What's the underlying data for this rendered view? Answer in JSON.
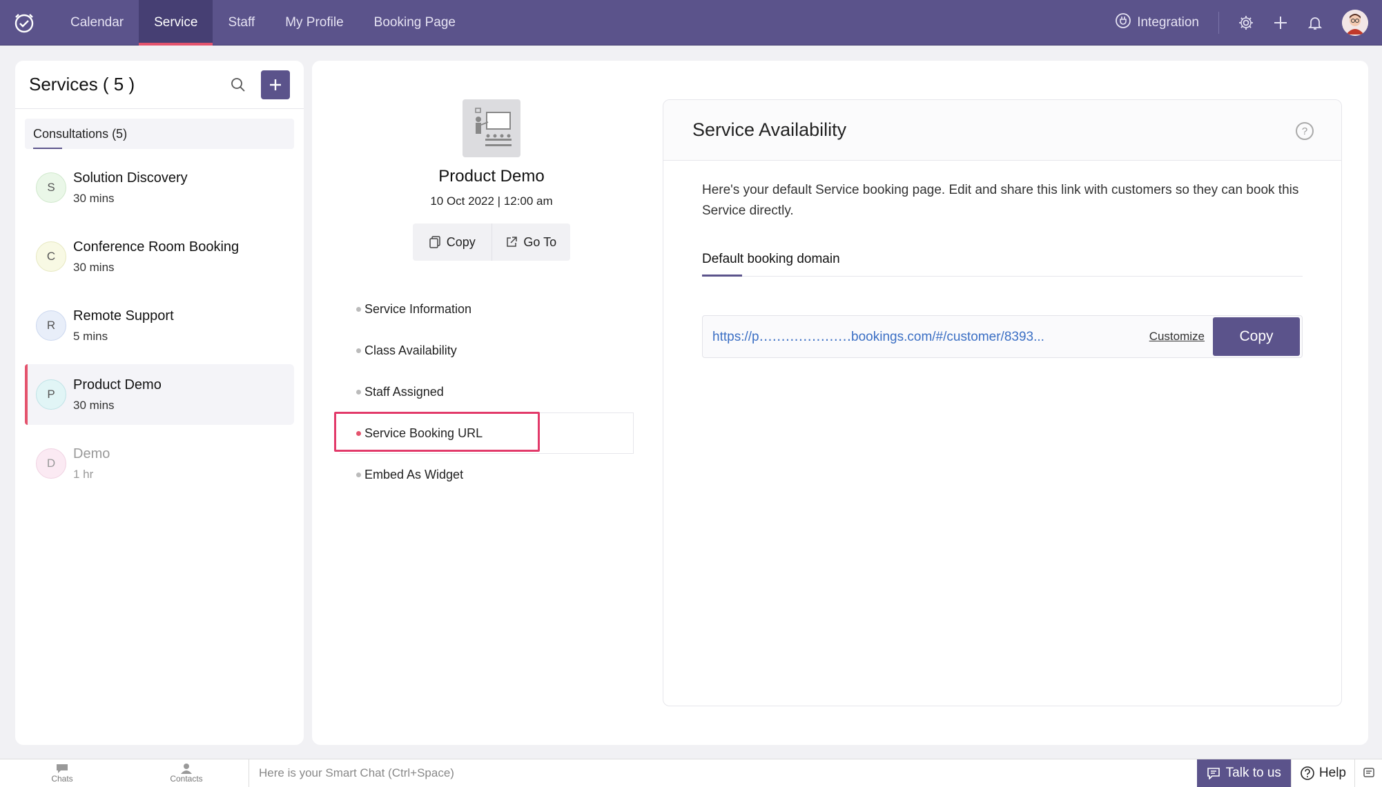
{
  "nav": {
    "items": [
      {
        "label": "Calendar"
      },
      {
        "label": "Service"
      },
      {
        "label": "Staff"
      },
      {
        "label": "My Profile"
      },
      {
        "label": "Booking Page"
      }
    ],
    "integration_label": "Integration",
    "accent": "#5b538b",
    "highlight": "#e4536d"
  },
  "left": {
    "title": "Services ( 5 )",
    "category": "Consultations (5)",
    "services": [
      {
        "initial": "S",
        "name": "Solution Discovery",
        "duration": "30 mins",
        "badge_color": "#eaf7e8"
      },
      {
        "initial": "C",
        "name": "Conference Room Booking",
        "duration": "30 mins",
        "badge_color": "#f8f9e4"
      },
      {
        "initial": "R",
        "name": "Remote Support",
        "duration": "5 mins",
        "badge_color": "#e8eef9"
      },
      {
        "initial": "P",
        "name": "Product Demo",
        "duration": "30 mins",
        "badge_color": "#e1f5f6"
      },
      {
        "initial": "D",
        "name": "Demo",
        "duration": "1 hr",
        "badge_color": "#fbeaf3"
      }
    ]
  },
  "summary": {
    "name": "Product Demo",
    "date": "10 Oct 2022 | 12:00 am",
    "copy_label": "Copy",
    "goto_label": "Go To"
  },
  "menu": {
    "items": [
      {
        "label": "Service Information"
      },
      {
        "label": "Class Availability"
      },
      {
        "label": "Staff Assigned"
      },
      {
        "label": "Service Booking URL"
      },
      {
        "label": "Embed As Widget"
      }
    ]
  },
  "availability": {
    "title": "Service Availability",
    "help": "?",
    "description": "Here's your default Service booking page. Edit and share this link with customers so they can book this Service directly.",
    "tab_label": "Default booking domain",
    "url": "https://p․․․․․․․․․․․․․․․․․․․․․bookings.com/#/customer/8393...",
    "customize_label": "Customize",
    "copy_label": "Copy"
  },
  "bottom": {
    "chats": "Chats",
    "contacts": "Contacts",
    "smart_chat_placeholder": "Here is your Smart Chat (Ctrl+Space)",
    "talk_label": "Talk to us",
    "help_label": "Help"
  }
}
